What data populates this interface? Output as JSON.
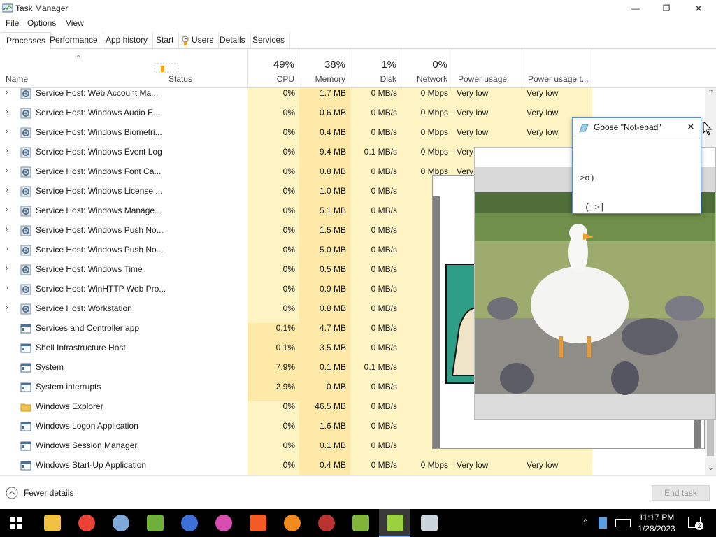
{
  "window": {
    "title": "Task Manager",
    "minimize": "—",
    "maximize": "❐",
    "close": "✕"
  },
  "menu": [
    "File",
    "Options",
    "View"
  ],
  "tabs": [
    "Processes",
    "Performance",
    "App history",
    "Start",
    "Users",
    "Details",
    "Services"
  ],
  "columns": {
    "name": "Name",
    "status": "Status",
    "cpu": {
      "pct": "49%",
      "label": "CPU"
    },
    "memory": {
      "pct": "38%",
      "label": "Memory"
    },
    "disk": {
      "pct": "1%",
      "label": "Disk"
    },
    "network": {
      "pct": "0%",
      "label": "Network"
    },
    "power": "Power usage",
    "power_trend": "Power usage t..."
  },
  "processes": [
    {
      "name": "Service Host: Web Account Ma...",
      "expandable": true,
      "icon": "gear",
      "cpu": "0%",
      "mem": "1.7 MB",
      "disk": "0 MB/s",
      "net": "0 Mbps",
      "power": "Very low",
      "trend": "Very low"
    },
    {
      "name": "Service Host: Windows Audio E...",
      "expandable": true,
      "icon": "gear",
      "cpu": "0%",
      "mem": "0.6 MB",
      "disk": "0 MB/s",
      "net": "0 Mbps",
      "power": "Very low",
      "trend": "Very low"
    },
    {
      "name": "Service Host: Windows Biometri...",
      "expandable": true,
      "icon": "gear",
      "cpu": "0%",
      "mem": "0.4 MB",
      "disk": "0 MB/s",
      "net": "0 Mbps",
      "power": "Very low",
      "trend": "Very low"
    },
    {
      "name": "Service Host: Windows Event Log",
      "expandable": true,
      "icon": "gear",
      "cpu": "0%",
      "mem": "9.4 MB",
      "disk": "0.1 MB/s",
      "net": "0 Mbps",
      "power": "Very",
      "trend": ""
    },
    {
      "name": "Service Host: Windows Font Ca...",
      "expandable": true,
      "icon": "gear",
      "cpu": "0%",
      "mem": "0.8 MB",
      "disk": "0 MB/s",
      "net": "0 Mbps",
      "power": "Very",
      "trend": ""
    },
    {
      "name": "Service Host: Windows License ...",
      "expandable": true,
      "icon": "gear",
      "cpu": "0%",
      "mem": "1.0 MB",
      "disk": "0 MB/s",
      "net": "0 M",
      "power": "",
      "trend": ""
    },
    {
      "name": "Service Host: Windows Manage...",
      "expandable": true,
      "icon": "gear",
      "cpu": "0%",
      "mem": "5.1 MB",
      "disk": "0 MB/s",
      "net": "0 M",
      "power": "",
      "trend": ""
    },
    {
      "name": "Service Host: Windows Push No...",
      "expandable": true,
      "icon": "gear",
      "cpu": "0%",
      "mem": "1.5 MB",
      "disk": "0 MB/s",
      "net": "0 M",
      "power": "",
      "trend": ""
    },
    {
      "name": "Service Host: Windows Push No...",
      "expandable": true,
      "icon": "gear",
      "cpu": "0%",
      "mem": "5.0 MB",
      "disk": "0 MB/s",
      "net": "0 M",
      "power": "",
      "trend": ""
    },
    {
      "name": "Service Host: Windows Time",
      "expandable": true,
      "icon": "gear",
      "cpu": "0%",
      "mem": "0.5 MB",
      "disk": "0 MB/s",
      "net": "0 M",
      "power": "",
      "trend": ""
    },
    {
      "name": "Service Host: WinHTTP Web Pro...",
      "expandable": true,
      "icon": "gear",
      "cpu": "0%",
      "mem": "0.9 MB",
      "disk": "0 MB/s",
      "net": "0 M",
      "power": "",
      "trend": ""
    },
    {
      "name": "Service Host: Workstation",
      "expandable": true,
      "icon": "gear",
      "cpu": "0%",
      "mem": "0.8 MB",
      "disk": "0 MB/s",
      "net": "0 M",
      "power": "",
      "trend": ""
    },
    {
      "name": "Services and Controller app",
      "expandable": false,
      "icon": "window",
      "cpu": "0.1%",
      "mem": "4.7 MB",
      "disk": "0 MB/s",
      "net": "0 M",
      "power": "",
      "trend": ""
    },
    {
      "name": "Shell Infrastructure Host",
      "expandable": false,
      "icon": "window",
      "cpu": "0.1%",
      "mem": "3.5 MB",
      "disk": "0 MB/s",
      "net": "0 M",
      "power": "",
      "trend": ""
    },
    {
      "name": "System",
      "expandable": false,
      "icon": "window",
      "cpu": "7.9%",
      "mem": "0.1 MB",
      "disk": "0.1 MB/s",
      "net": "0 M",
      "power": "",
      "trend": ""
    },
    {
      "name": "System interrupts",
      "expandable": false,
      "icon": "window",
      "cpu": "2.9%",
      "mem": "0 MB",
      "disk": "0 MB/s",
      "net": "0 M",
      "power": "",
      "trend": ""
    },
    {
      "name": "Windows Explorer",
      "expandable": false,
      "icon": "folder",
      "cpu": "0%",
      "mem": "46.5 MB",
      "disk": "0 MB/s",
      "net": "0 M",
      "power": "",
      "trend": ""
    },
    {
      "name": "Windows Logon Application",
      "expandable": false,
      "icon": "window",
      "cpu": "0%",
      "mem": "1.6 MB",
      "disk": "0 MB/s",
      "net": "0 M",
      "power": "",
      "trend": ""
    },
    {
      "name": "Windows Session Manager",
      "expandable": false,
      "icon": "window",
      "cpu": "0%",
      "mem": "0.1 MB",
      "disk": "0 MB/s",
      "net": "0 M",
      "power": "",
      "trend": ""
    },
    {
      "name": "Windows Start-Up Application",
      "expandable": false,
      "icon": "window",
      "cpu": "0%",
      "mem": "0.4 MB",
      "disk": "0 MB/s",
      "net": "0 Mbps",
      "power": "Very low",
      "trend": "Very low"
    }
  ],
  "footer": {
    "fewer_details": "Fewer details",
    "end_task": "End task"
  },
  "goose_window": {
    "title": "Goose \"Not-epad\"",
    "text_line1": ">o)",
    "text_line2": " (_>|"
  },
  "taskbar": {
    "time": "11:17 PM",
    "date": "1/28/2023",
    "notification_count": "2"
  },
  "colors": {
    "highlight_light": "#fff4c4",
    "highlight_medium": "#ffe9a8",
    "taskbar": "#000000",
    "accent": "#0078d7"
  }
}
